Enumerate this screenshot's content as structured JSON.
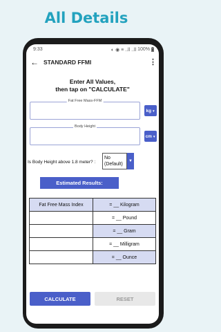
{
  "promo": {
    "headline": "All Details"
  },
  "status_bar": {
    "time": "9:33",
    "icons": "◐ ◉ ≡ ..ll ..ll",
    "battery": "100%"
  },
  "app_bar": {
    "back_icon": "←",
    "title": "STANDARD FFMI",
    "menu_icon": "⋮"
  },
  "instructions": {
    "line1": "Enter All Values,",
    "line2": "then tap on \"CALCULATE\""
  },
  "fields": [
    {
      "label": "Fat Free Mass-FFM",
      "value": "",
      "unit": "kg"
    },
    {
      "label": "Body Height",
      "value": "",
      "unit": "cm"
    }
  ],
  "question": {
    "text": "Is Body Height above 1.8 meter? :",
    "selected_line1": "No",
    "selected_line2": "(Default)"
  },
  "results": {
    "header": "Estimated Results:",
    "rows": [
      {
        "label": "Fat Free Mass Index",
        "value": "= __ Kilogram"
      },
      {
        "label": "",
        "value": "= __ Pound"
      },
      {
        "label": "",
        "value": "= __ Gram"
      },
      {
        "label": "",
        "value": "= __ Milligram"
      },
      {
        "label": "",
        "value": "= __ Ounce"
      }
    ]
  },
  "buttons": {
    "calculate": "CALCULATE",
    "reset": "RESET"
  },
  "colors": {
    "accent": "#4a5fc9",
    "headline": "#23a2be",
    "table_shade": "#d6dbf2"
  }
}
